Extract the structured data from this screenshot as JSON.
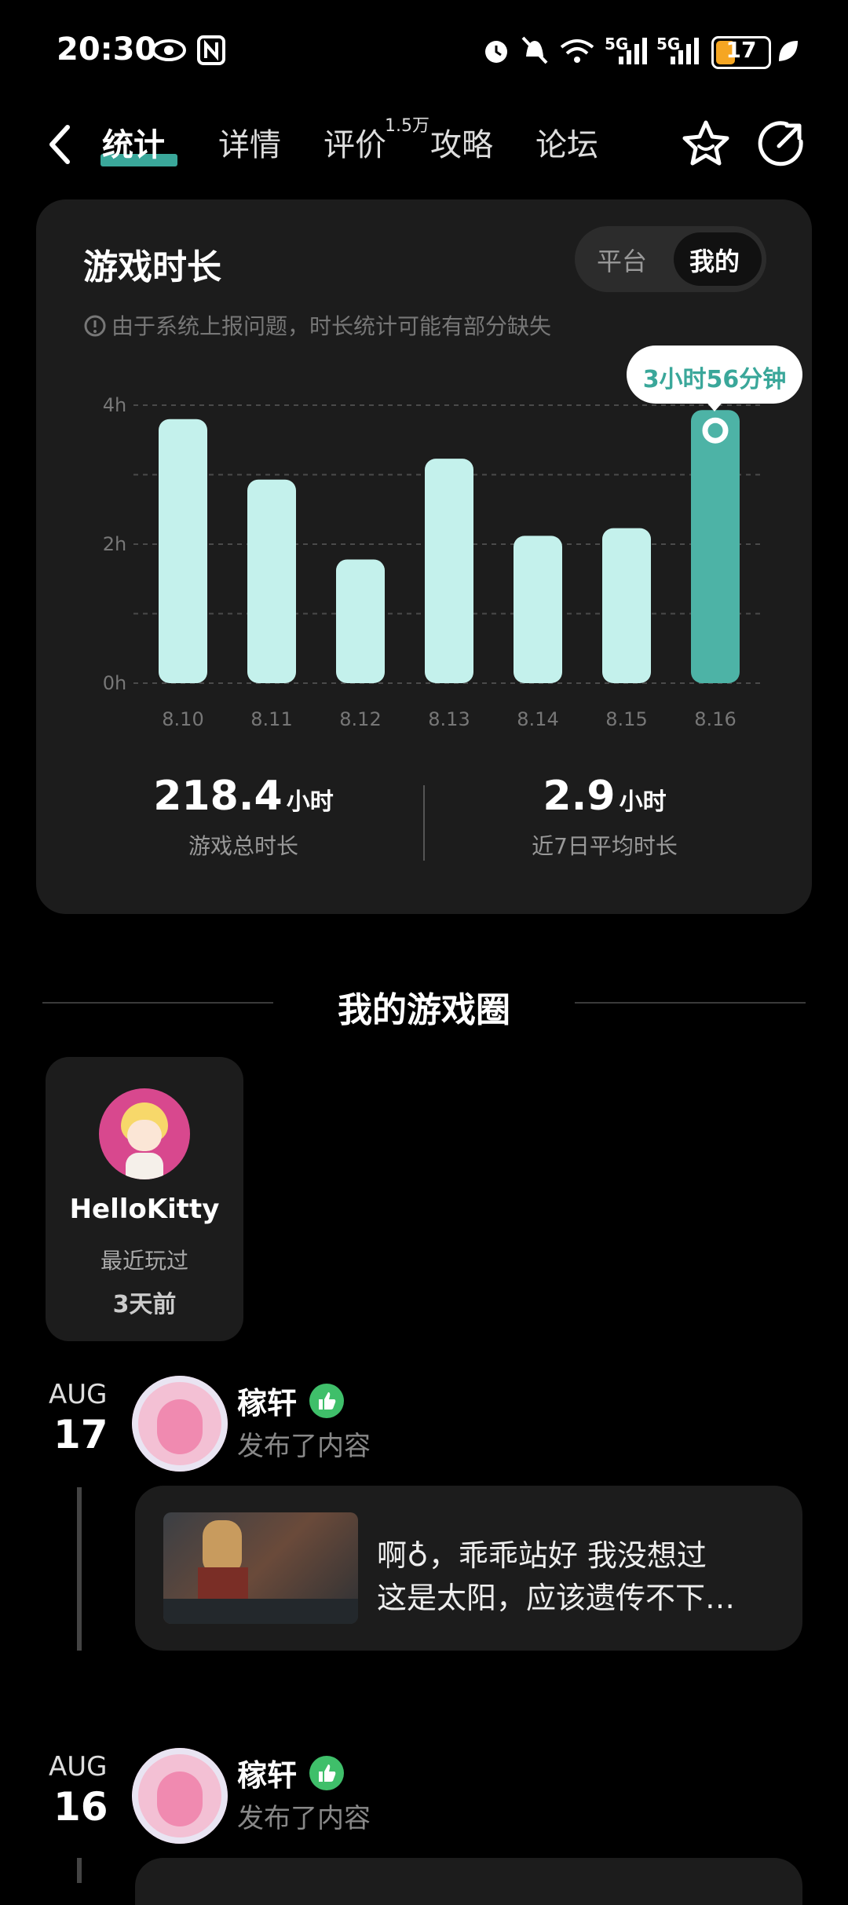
{
  "status_bar": {
    "time": "20:30",
    "network": "5G",
    "network2": "5G",
    "battery": "17",
    "icons": [
      "eye-icon",
      "nfc-icon",
      "alarm-icon",
      "mute-icon",
      "wifi-icon",
      "signal-icon",
      "battery-icon",
      "leaf-icon"
    ]
  },
  "nav": {
    "tabs": [
      "统计",
      "详情",
      "评价",
      "攻略",
      "论坛"
    ],
    "active_tab": "统计",
    "review_badge": "1.5万"
  },
  "playtime": {
    "title": "游戏时长",
    "toggle": [
      "平台",
      "我的"
    ],
    "toggle_selected": "我的",
    "notice": "由于系统上报问题，时长统计可能有部分缺失",
    "tooltip": "3小时56分钟",
    "total_value": "218.4",
    "total_unit": "小时",
    "total_label": "游戏总时长",
    "avg_value": "2.9",
    "avg_unit": "小时",
    "avg_label": "近7日平均时长"
  },
  "chart_data": {
    "type": "bar",
    "categories": [
      "8.10",
      "8.11",
      "8.12",
      "8.13",
      "8.14",
      "8.15",
      "8.16"
    ],
    "values": [
      3.8,
      2.93,
      1.78,
      3.23,
      2.12,
      2.23,
      3.93
    ],
    "unit": "h",
    "yticks": [
      "0h",
      "2h",
      "4h"
    ],
    "ylim": [
      0,
      4
    ],
    "highlighted": "8.16",
    "colors": {
      "bar": "#c4f1ec",
      "highlight": "#4db3a6"
    }
  },
  "circle": {
    "title": "我的游戏圈",
    "game": {
      "name": "HelloKitty",
      "recent_label": "最近玩过",
      "ago": "3天前"
    }
  },
  "feed": [
    {
      "month": "AUG",
      "day": "17",
      "user": "稼轩",
      "action": "发布了内容",
      "post_line1": "啊♁，乖乖站好 我没想过",
      "post_line2": "这是太阳，应该遗传不下…"
    },
    {
      "month": "AUG",
      "day": "16",
      "user": "稼轩",
      "action": "发布了内容"
    }
  ]
}
